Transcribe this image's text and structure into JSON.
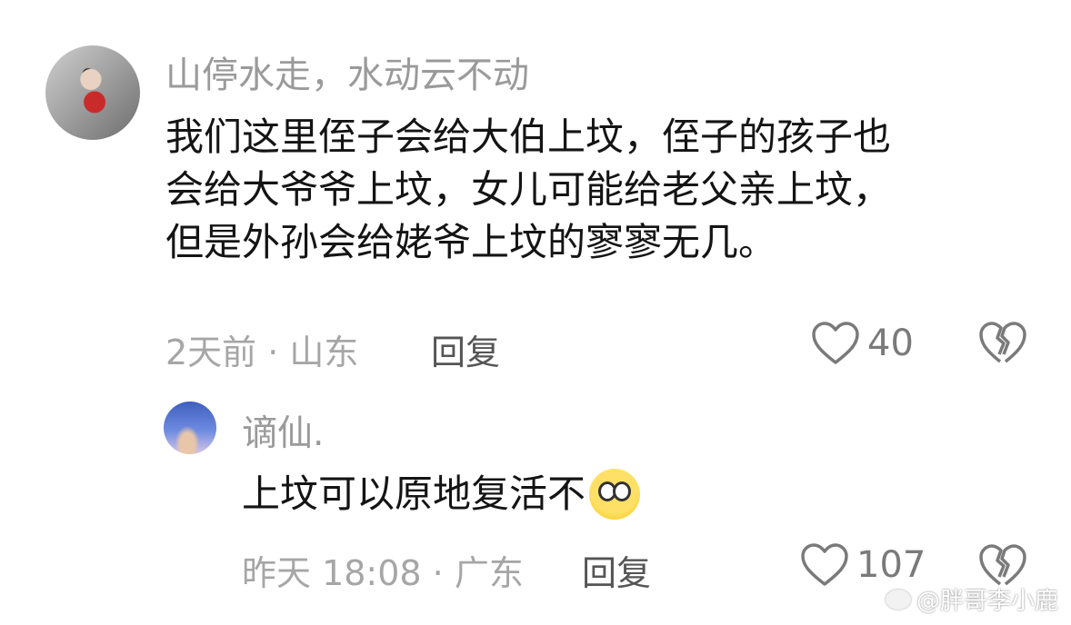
{
  "comments": [
    {
      "username": "山停水走，水动云不动",
      "text_lines": [
        "我们这里侄子会给大伯上坟，侄子的孩子也",
        "会给大爷爷上坟，女儿可能给老父亲上坟，",
        "但是外孙会给姥爷上坟的寥寥无几。"
      ],
      "meta": "2天前 · 山东",
      "reply_label": "回复",
      "likes": "40"
    },
    {
      "username": "谪仙.",
      "text": "上坟可以原地复活不",
      "emoji": "flushed-face-emoji",
      "meta": "昨天 18:08 · 广东",
      "reply_label": "回复",
      "likes": "107"
    }
  ],
  "icons": {
    "like": "heart-outline-icon",
    "dislike": "broken-heart-icon"
  },
  "watermark": "@胖哥李小鹿",
  "colors": {
    "username": "#9a9a9a",
    "text": "#141414",
    "meta": "#a6a6a6",
    "reply": "#555555",
    "icon": "#7a7a7a"
  }
}
